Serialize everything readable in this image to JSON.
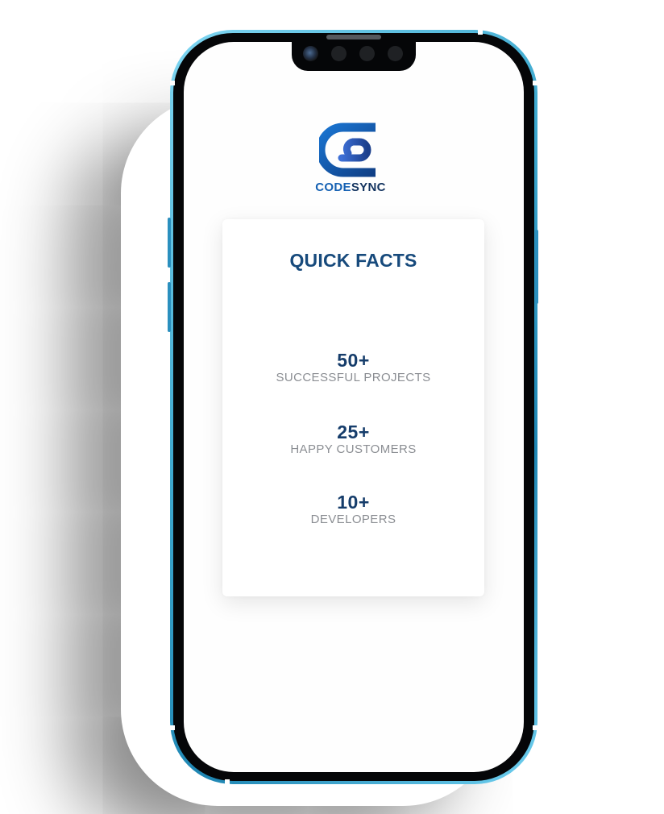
{
  "brand": {
    "name_part1": "CODE",
    "name_part2": "SYNC",
    "primary_color": "#1561b3",
    "dark_color": "#13335f"
  },
  "card": {
    "title": "QUICK FACTS",
    "facts": [
      {
        "value": "50+",
        "label": "SUCCESSFUL PROJECTS"
      },
      {
        "value": "25+",
        "label": "HAPPY CUSTOMERS"
      },
      {
        "value": "10+",
        "label": "DEVELOPERS"
      }
    ]
  },
  "device": {
    "frame_color": "#3ea9cf",
    "bezel_color": "#050608"
  },
  "icons": {
    "logo": "codesync-logo-icon",
    "camera": "front-camera-icon"
  }
}
